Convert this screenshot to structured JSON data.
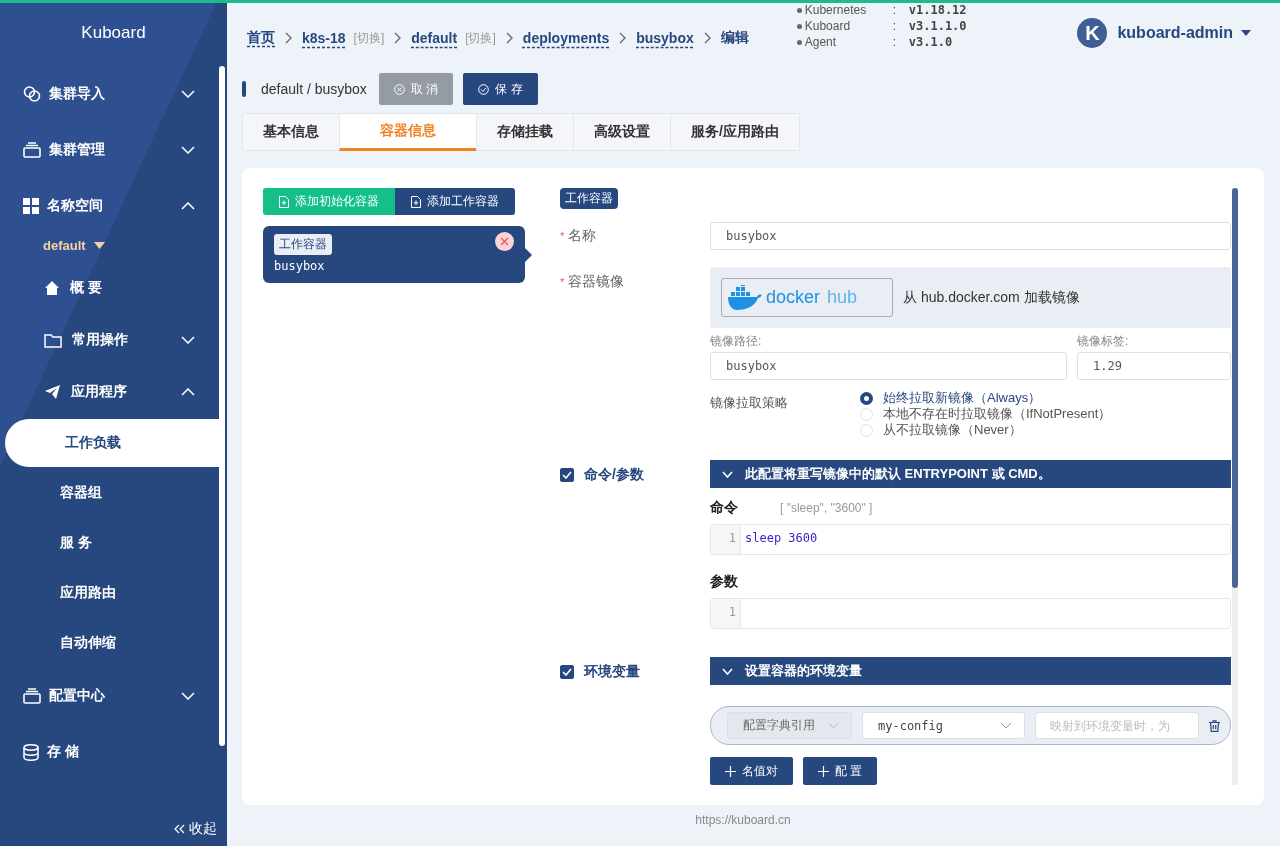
{
  "sidebar": {
    "logo": "Kuboard",
    "items": [
      {
        "kind": "group",
        "label": "集群导入",
        "expanded": false
      },
      {
        "kind": "group",
        "label": "集群管理",
        "expanded": false
      },
      {
        "kind": "group",
        "label": "名称空间",
        "expanded": true,
        "children": [
          {
            "kind": "namespace",
            "label": "default"
          },
          {
            "kind": "link",
            "label": "概 要",
            "selected": false
          },
          {
            "kind": "group",
            "label": "常用操作",
            "expanded": false
          },
          {
            "kind": "group",
            "label": "应用程序",
            "expanded": true,
            "children": [
              {
                "kind": "link",
                "label": "工作负载",
                "selected": true
              },
              {
                "kind": "link",
                "label": "容器组",
                "selected": false
              },
              {
                "kind": "link",
                "label": "服 务",
                "selected": false
              },
              {
                "kind": "link",
                "label": "应用路由",
                "selected": false
              },
              {
                "kind": "link",
                "label": "自动伸缩",
                "selected": false
              }
            ]
          }
        ]
      },
      {
        "kind": "group",
        "label": "配置中心",
        "expanded": false
      },
      {
        "kind": "link",
        "label": "存 储",
        "selected": false
      }
    ],
    "collapse": "收起"
  },
  "breadcrumb": [
    {
      "text": "首页",
      "link": true
    },
    {
      "text": "k8s-18",
      "link": true,
      "switch": "[切换]"
    },
    {
      "text": "default",
      "link": true,
      "switch": "[切换]"
    },
    {
      "text": "deployments",
      "link": true
    },
    {
      "text": "busybox",
      "link": true
    },
    {
      "text": "编辑",
      "link": false
    }
  ],
  "versions": [
    {
      "name": "Kubernetes",
      "sep": ":",
      "value": "v1.18.12"
    },
    {
      "name": "Kuboard",
      "sep": ":",
      "value": "v3.1.1.0"
    },
    {
      "name": "Agent",
      "sep": ":",
      "value": "v3.1.0"
    }
  ],
  "user": {
    "avatar": "K",
    "name": "kuboard-admin"
  },
  "header": {
    "title": "default / busybox",
    "buttons": [
      {
        "kind": "cancel",
        "label": "取 消"
      },
      {
        "kind": "save",
        "label": "保 存"
      }
    ]
  },
  "tabs": [
    {
      "label": "基本信息",
      "selected": false
    },
    {
      "label": "容器信息",
      "selected": true
    },
    {
      "label": "存储挂载",
      "selected": false
    },
    {
      "label": "高级设置",
      "selected": false
    },
    {
      "label": "服务/应用路由",
      "selected": false
    }
  ],
  "containers": {
    "add_buttons": [
      {
        "kind": "init",
        "label": "添加初始化容器"
      },
      {
        "kind": "work",
        "label": "添加工作容器"
      }
    ],
    "list": [
      {
        "tag": "工作容器",
        "name": "busybox",
        "selected": true
      }
    ]
  },
  "form": {
    "type_tag": "工作容器",
    "name": {
      "label": "名称",
      "required_mark": "*",
      "value": "busybox"
    },
    "image": {
      "label": "容器镜像",
      "required_mark": "*",
      "logo_words": [
        "docker",
        "hub"
      ],
      "registry_text": "从 hub.docker.com 加载镜像",
      "path_label": "镜像路径:",
      "path": "busybox",
      "tag_label": "镜像标签:",
      "tag": "1.29"
    },
    "pull_policy": {
      "label": "镜像拉取策略",
      "options": [
        {
          "label": "始终拉取新镜像（Always）",
          "selected": true
        },
        {
          "label": "本地不存在时拉取镜像（IfNotPresent）",
          "selected": false
        },
        {
          "label": "从不拉取镜像（Never）",
          "selected": false
        }
      ]
    },
    "command": {
      "label": "命令/参数",
      "checked": true,
      "banner": "此配置将重写镜像中的默认 ENTRYPOINT 或 CMD。",
      "command_label": "命令",
      "command_hint": "[ \"sleep\", \"3600\" ]",
      "command_lines": [
        {
          "number": "1",
          "code": "sleep 3600"
        }
      ],
      "args_label": "参数",
      "args_lines": [
        {
          "number": "1"
        }
      ]
    },
    "env": {
      "label": "环境变量",
      "checked": true,
      "banner": "设置容器的环境变量",
      "row": {
        "source": "配置字典引用",
        "config": "my-config",
        "placeholder": "映射到环境变量时，为"
      },
      "buttons": [
        "名值对",
        "配 置"
      ]
    }
  },
  "footer": "https://kuboard.cn"
}
